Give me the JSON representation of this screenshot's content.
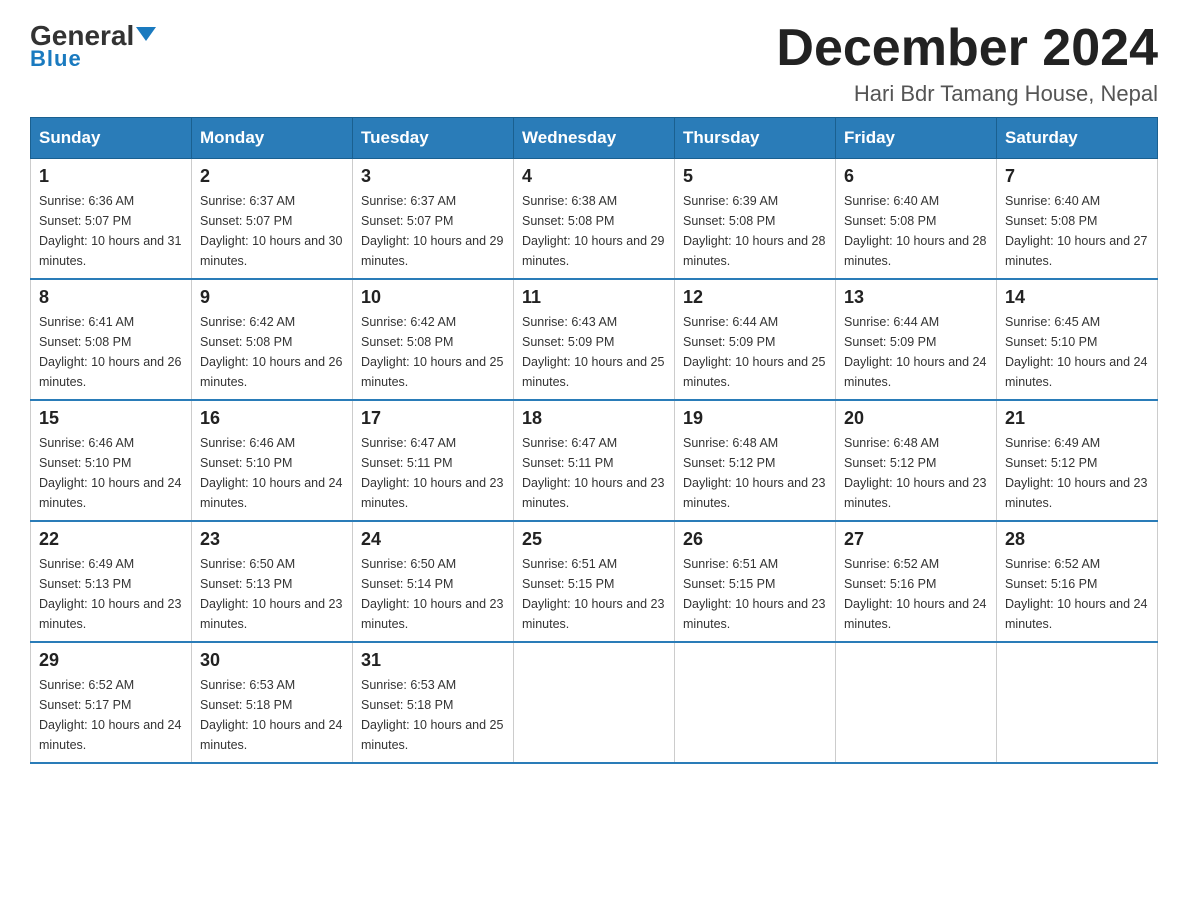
{
  "logo": {
    "general": "General",
    "blue": "Blue"
  },
  "header": {
    "month": "December 2024",
    "location": "Hari Bdr Tamang House, Nepal"
  },
  "weekdays": [
    "Sunday",
    "Monday",
    "Tuesday",
    "Wednesday",
    "Thursday",
    "Friday",
    "Saturday"
  ],
  "weeks": [
    [
      {
        "day": "1",
        "sunrise": "6:36 AM",
        "sunset": "5:07 PM",
        "daylight": "10 hours and 31 minutes."
      },
      {
        "day": "2",
        "sunrise": "6:37 AM",
        "sunset": "5:07 PM",
        "daylight": "10 hours and 30 minutes."
      },
      {
        "day": "3",
        "sunrise": "6:37 AM",
        "sunset": "5:07 PM",
        "daylight": "10 hours and 29 minutes."
      },
      {
        "day": "4",
        "sunrise": "6:38 AM",
        "sunset": "5:08 PM",
        "daylight": "10 hours and 29 minutes."
      },
      {
        "day": "5",
        "sunrise": "6:39 AM",
        "sunset": "5:08 PM",
        "daylight": "10 hours and 28 minutes."
      },
      {
        "day": "6",
        "sunrise": "6:40 AM",
        "sunset": "5:08 PM",
        "daylight": "10 hours and 28 minutes."
      },
      {
        "day": "7",
        "sunrise": "6:40 AM",
        "sunset": "5:08 PM",
        "daylight": "10 hours and 27 minutes."
      }
    ],
    [
      {
        "day": "8",
        "sunrise": "6:41 AM",
        "sunset": "5:08 PM",
        "daylight": "10 hours and 26 minutes."
      },
      {
        "day": "9",
        "sunrise": "6:42 AM",
        "sunset": "5:08 PM",
        "daylight": "10 hours and 26 minutes."
      },
      {
        "day": "10",
        "sunrise": "6:42 AM",
        "sunset": "5:08 PM",
        "daylight": "10 hours and 25 minutes."
      },
      {
        "day": "11",
        "sunrise": "6:43 AM",
        "sunset": "5:09 PM",
        "daylight": "10 hours and 25 minutes."
      },
      {
        "day": "12",
        "sunrise": "6:44 AM",
        "sunset": "5:09 PM",
        "daylight": "10 hours and 25 minutes."
      },
      {
        "day": "13",
        "sunrise": "6:44 AM",
        "sunset": "5:09 PM",
        "daylight": "10 hours and 24 minutes."
      },
      {
        "day": "14",
        "sunrise": "6:45 AM",
        "sunset": "5:10 PM",
        "daylight": "10 hours and 24 minutes."
      }
    ],
    [
      {
        "day": "15",
        "sunrise": "6:46 AM",
        "sunset": "5:10 PM",
        "daylight": "10 hours and 24 minutes."
      },
      {
        "day": "16",
        "sunrise": "6:46 AM",
        "sunset": "5:10 PM",
        "daylight": "10 hours and 24 minutes."
      },
      {
        "day": "17",
        "sunrise": "6:47 AM",
        "sunset": "5:11 PM",
        "daylight": "10 hours and 23 minutes."
      },
      {
        "day": "18",
        "sunrise": "6:47 AM",
        "sunset": "5:11 PM",
        "daylight": "10 hours and 23 minutes."
      },
      {
        "day": "19",
        "sunrise": "6:48 AM",
        "sunset": "5:12 PM",
        "daylight": "10 hours and 23 minutes."
      },
      {
        "day": "20",
        "sunrise": "6:48 AM",
        "sunset": "5:12 PM",
        "daylight": "10 hours and 23 minutes."
      },
      {
        "day": "21",
        "sunrise": "6:49 AM",
        "sunset": "5:12 PM",
        "daylight": "10 hours and 23 minutes."
      }
    ],
    [
      {
        "day": "22",
        "sunrise": "6:49 AM",
        "sunset": "5:13 PM",
        "daylight": "10 hours and 23 minutes."
      },
      {
        "day": "23",
        "sunrise": "6:50 AM",
        "sunset": "5:13 PM",
        "daylight": "10 hours and 23 minutes."
      },
      {
        "day": "24",
        "sunrise": "6:50 AM",
        "sunset": "5:14 PM",
        "daylight": "10 hours and 23 minutes."
      },
      {
        "day": "25",
        "sunrise": "6:51 AM",
        "sunset": "5:15 PM",
        "daylight": "10 hours and 23 minutes."
      },
      {
        "day": "26",
        "sunrise": "6:51 AM",
        "sunset": "5:15 PM",
        "daylight": "10 hours and 23 minutes."
      },
      {
        "day": "27",
        "sunrise": "6:52 AM",
        "sunset": "5:16 PM",
        "daylight": "10 hours and 24 minutes."
      },
      {
        "day": "28",
        "sunrise": "6:52 AM",
        "sunset": "5:16 PM",
        "daylight": "10 hours and 24 minutes."
      }
    ],
    [
      {
        "day": "29",
        "sunrise": "6:52 AM",
        "sunset": "5:17 PM",
        "daylight": "10 hours and 24 minutes."
      },
      {
        "day": "30",
        "sunrise": "6:53 AM",
        "sunset": "5:18 PM",
        "daylight": "10 hours and 24 minutes."
      },
      {
        "day": "31",
        "sunrise": "6:53 AM",
        "sunset": "5:18 PM",
        "daylight": "10 hours and 25 minutes."
      },
      null,
      null,
      null,
      null
    ]
  ]
}
